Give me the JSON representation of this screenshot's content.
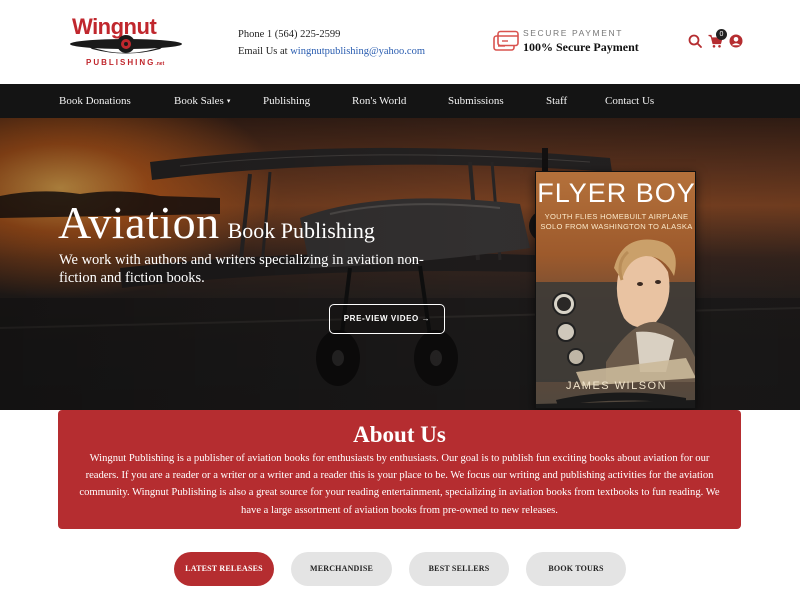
{
  "brand": {
    "logo_word": "Wingnut",
    "logo_sub": "PUBLISHING",
    "logo_sub_suffix": ".net",
    "accent_color": "#b52d30"
  },
  "contact": {
    "phone_label": "Phone 1 (564) 225-2599",
    "email_label": "Email Us at ",
    "email": "wingnutpublishing@yahoo.com"
  },
  "secure": {
    "small": "SECURE PAYMENT",
    "big": "100% Secure Payment",
    "icon": "credit-card-icon"
  },
  "header_icons": {
    "search": "search-icon",
    "cart": "cart-icon",
    "cart_count": "0",
    "account": "user-icon"
  },
  "nav": {
    "items": [
      {
        "label": "Book Donations"
      },
      {
        "label": "Book Sales",
        "has_dropdown": true
      },
      {
        "label": "Publishing"
      },
      {
        "label": "Ron's World"
      },
      {
        "label": "Submissions"
      },
      {
        "label": "Staff"
      },
      {
        "label": "Contact Us"
      }
    ],
    "caret": "▾"
  },
  "hero": {
    "title_big": "Aviation",
    "title_small": "Book Publishing",
    "description": "We work with authors and writers specializing in aviation non-fiction and fiction books.",
    "button_label": "PRE-VIEW VIDEO →"
  },
  "book": {
    "title": "FLYER BOY",
    "subtitle_line1": "YOUTH FLIES HOMEBUILT AIRPLANE",
    "subtitle_line2": "SOLO FROM WASHINGTON TO ALASKA",
    "author": "JAMES WILSON"
  },
  "about": {
    "title": "About Us",
    "text": "Wingnut Publishing is a publisher of aviation books for enthusiasts by enthusiasts. Our goal is to publish fun exciting books about aviation for our readers. If you are a reader or a writer or a writer and a reader this is your place to be. We focus our writing and publishing activities for the aviation community. Wingnut Publishing is also a great source for your reading entertainment, specializing in aviation books from textbooks to fun reading. We have a large assortment of aviation books from pre-owned to new releases."
  },
  "tabs": [
    {
      "label": "LATEST RELEASES",
      "active": true
    },
    {
      "label": "MERCHANDISE",
      "active": false
    },
    {
      "label": "BEST SELLERS",
      "active": false
    },
    {
      "label": "BOOK TOURS",
      "active": false
    }
  ]
}
